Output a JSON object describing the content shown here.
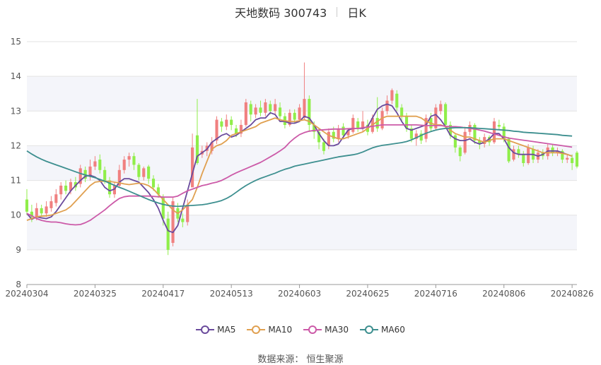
{
  "header": {
    "title": "天地数码 300743",
    "period": "日K"
  },
  "footer": {
    "source": "数据来源： 恒生聚源"
  },
  "chart_data": {
    "type": "candlestick",
    "colors": {
      "up": "#f08080",
      "down": "#90ee4a",
      "MA5": "#6a4a9c",
      "MA10": "#e0a050",
      "MA30": "#cc5aa8",
      "MA60": "#3d8f8f"
    },
    "ylim": [
      8,
      15
    ],
    "yticks": [
      8,
      9,
      10,
      11,
      12,
      13,
      14,
      15
    ],
    "xtick_labels": [
      "20240304",
      "20240325",
      "20240417",
      "20240513",
      "20240603",
      "20240625",
      "20240716",
      "20240806",
      "20240826"
    ],
    "xtick_positions": [
      0,
      14,
      28,
      42,
      56,
      70,
      84,
      98,
      112
    ],
    "legend": [
      "MA5",
      "MA10",
      "MA30",
      "MA60"
    ],
    "candles": [
      {
        "o": 10.45,
        "c": 10.1,
        "h": 10.75,
        "l": 10.0
      },
      {
        "o": 10.1,
        "c": 9.95,
        "h": 10.3,
        "l": 9.8
      },
      {
        "o": 9.95,
        "c": 10.2,
        "h": 10.35,
        "l": 9.85
      },
      {
        "o": 10.2,
        "c": 10.05,
        "h": 10.3,
        "l": 9.95
      },
      {
        "o": 10.05,
        "c": 10.25,
        "h": 10.4,
        "l": 9.95
      },
      {
        "o": 10.2,
        "c": 10.4,
        "h": 10.55,
        "l": 10.1
      },
      {
        "o": 10.35,
        "c": 10.6,
        "h": 10.75,
        "l": 10.25
      },
      {
        "o": 10.6,
        "c": 10.85,
        "h": 10.95,
        "l": 10.45
      },
      {
        "o": 10.85,
        "c": 10.7,
        "h": 11.0,
        "l": 10.6
      },
      {
        "o": 10.7,
        "c": 10.95,
        "h": 11.05,
        "l": 10.6
      },
      {
        "o": 10.95,
        "c": 10.8,
        "h": 11.1,
        "l": 10.7
      },
      {
        "o": 10.9,
        "c": 11.35,
        "h": 11.45,
        "l": 10.8
      },
      {
        "o": 11.3,
        "c": 11.05,
        "h": 11.4,
        "l": 10.95
      },
      {
        "o": 11.1,
        "c": 11.4,
        "h": 11.6,
        "l": 11.0
      },
      {
        "o": 11.4,
        "c": 11.55,
        "h": 11.7,
        "l": 11.3
      },
      {
        "o": 11.6,
        "c": 11.3,
        "h": 11.75,
        "l": 11.2
      },
      {
        "o": 11.3,
        "c": 11.0,
        "h": 11.4,
        "l": 10.9
      },
      {
        "o": 11.0,
        "c": 10.6,
        "h": 11.1,
        "l": 10.5
      },
      {
        "o": 10.6,
        "c": 10.85,
        "h": 10.95,
        "l": 10.5
      },
      {
        "o": 10.85,
        "c": 11.3,
        "h": 11.45,
        "l": 10.8
      },
      {
        "o": 11.3,
        "c": 11.6,
        "h": 11.7,
        "l": 11.2
      },
      {
        "o": 11.6,
        "c": 11.7,
        "h": 11.8,
        "l": 11.4
      },
      {
        "o": 11.7,
        "c": 11.45,
        "h": 11.8,
        "l": 11.3
      },
      {
        "o": 11.45,
        "c": 11.1,
        "h": 11.5,
        "l": 11.0
      },
      {
        "o": 11.1,
        "c": 11.35,
        "h": 11.4,
        "l": 11.0
      },
      {
        "o": 11.4,
        "c": 11.05,
        "h": 11.45,
        "l": 10.9
      },
      {
        "o": 11.05,
        "c": 10.8,
        "h": 11.15,
        "l": 10.7
      },
      {
        "o": 10.8,
        "c": 10.6,
        "h": 10.9,
        "l": 10.5
      },
      {
        "o": 10.5,
        "c": 9.9,
        "h": 10.6,
        "l": 9.7
      },
      {
        "o": 9.9,
        "c": 9.0,
        "h": 10.1,
        "l": 8.85
      },
      {
        "o": 9.2,
        "c": 10.4,
        "h": 10.5,
        "l": 9.1
      },
      {
        "o": 10.2,
        "c": 9.9,
        "h": 10.35,
        "l": 9.8
      },
      {
        "o": 9.9,
        "c": 9.8,
        "h": 10.05,
        "l": 9.65
      },
      {
        "o": 9.8,
        "c": 10.3,
        "h": 10.45,
        "l": 9.7
      },
      {
        "o": 10.8,
        "c": 11.95,
        "h": 12.35,
        "l": 11.2
      },
      {
        "o": 12.3,
        "c": 11.5,
        "h": 13.35,
        "l": 11.45
      },
      {
        "o": 11.75,
        "c": 11.85,
        "h": 12.0,
        "l": 11.65
      },
      {
        "o": 11.85,
        "c": 12.0,
        "h": 12.1,
        "l": 11.7
      },
      {
        "o": 11.85,
        "c": 12.1,
        "h": 12.25,
        "l": 11.75
      },
      {
        "o": 12.15,
        "c": 12.75,
        "h": 12.85,
        "l": 12.05
      },
      {
        "o": 12.7,
        "c": 12.55,
        "h": 12.8,
        "l": 12.4
      },
      {
        "o": 12.55,
        "c": 12.75,
        "h": 12.9,
        "l": 12.45
      },
      {
        "o": 12.75,
        "c": 12.6,
        "h": 12.85,
        "l": 12.45
      },
      {
        "o": 12.5,
        "c": 12.35,
        "h": 12.6,
        "l": 12.25
      },
      {
        "o": 12.35,
        "c": 12.6,
        "h": 12.75,
        "l": 12.25
      },
      {
        "o": 12.6,
        "c": 13.25,
        "h": 13.35,
        "l": 12.55
      },
      {
        "o": 13.2,
        "c": 12.9,
        "h": 13.3,
        "l": 12.7
      },
      {
        "o": 12.9,
        "c": 13.1,
        "h": 13.2,
        "l": 12.8
      },
      {
        "o": 13.1,
        "c": 12.95,
        "h": 13.3,
        "l": 12.85
      },
      {
        "o": 12.95,
        "c": 13.25,
        "h": 13.35,
        "l": 12.85
      },
      {
        "o": 13.2,
        "c": 13.0,
        "h": 13.3,
        "l": 12.9
      },
      {
        "o": 13.0,
        "c": 13.2,
        "h": 13.35,
        "l": 12.9
      },
      {
        "o": 13.1,
        "c": 12.85,
        "h": 13.25,
        "l": 12.75
      },
      {
        "o": 12.85,
        "c": 12.6,
        "h": 12.95,
        "l": 12.5
      },
      {
        "o": 12.6,
        "c": 12.95,
        "h": 13.05,
        "l": 12.55
      },
      {
        "o": 12.95,
        "c": 12.75,
        "h": 13.05,
        "l": 12.65
      },
      {
        "o": 12.75,
        "c": 13.1,
        "h": 13.2,
        "l": 12.7
      },
      {
        "o": 12.8,
        "c": 13.35,
        "h": 14.4,
        "l": 12.75
      },
      {
        "o": 13.35,
        "c": 12.6,
        "h": 13.45,
        "l": 12.4
      },
      {
        "o": 12.6,
        "c": 12.4,
        "h": 12.7,
        "l": 12.2
      },
      {
        "o": 12.4,
        "c": 12.1,
        "h": 12.5,
        "l": 11.9
      },
      {
        "o": 12.1,
        "c": 11.85,
        "h": 12.2,
        "l": 11.75
      },
      {
        "o": 12.0,
        "c": 12.4,
        "h": 12.5,
        "l": 11.9
      },
      {
        "o": 12.4,
        "c": 12.2,
        "h": 12.55,
        "l": 12.1
      },
      {
        "o": 12.2,
        "c": 12.5,
        "h": 12.6,
        "l": 12.1
      },
      {
        "o": 12.55,
        "c": 12.3,
        "h": 12.65,
        "l": 12.2
      },
      {
        "o": 12.3,
        "c": 12.45,
        "h": 12.5,
        "l": 12.2
      },
      {
        "o": 12.4,
        "c": 12.8,
        "h": 12.9,
        "l": 12.35
      },
      {
        "o": 12.7,
        "c": 12.5,
        "h": 12.8,
        "l": 12.4
      },
      {
        "o": 12.5,
        "c": 12.7,
        "h": 13.0,
        "l": 12.4
      },
      {
        "o": 12.6,
        "c": 12.4,
        "h": 12.75,
        "l": 12.3
      },
      {
        "o": 12.4,
        "c": 12.8,
        "h": 12.9,
        "l": 12.35
      },
      {
        "o": 12.8,
        "c": 12.5,
        "h": 13.4,
        "l": 12.4
      },
      {
        "o": 12.5,
        "c": 13.0,
        "h": 13.1,
        "l": 12.45
      },
      {
        "o": 13.0,
        "c": 13.3,
        "h": 13.45,
        "l": 12.9
      },
      {
        "o": 13.3,
        "c": 13.6,
        "h": 13.65,
        "l": 13.2
      },
      {
        "o": 13.5,
        "c": 13.1,
        "h": 13.6,
        "l": 13.0
      },
      {
        "o": 13.1,
        "c": 12.85,
        "h": 13.2,
        "l": 12.7
      },
      {
        "o": 12.85,
        "c": 12.5,
        "h": 12.95,
        "l": 12.4
      },
      {
        "o": 12.5,
        "c": 12.2,
        "h": 12.6,
        "l": 12.1
      },
      {
        "o": 12.2,
        "c": 12.35,
        "h": 12.45,
        "l": 12.0
      },
      {
        "o": 12.35,
        "c": 12.15,
        "h": 12.45,
        "l": 12.05
      },
      {
        "o": 12.2,
        "c": 12.8,
        "h": 12.9,
        "l": 12.1
      },
      {
        "o": 12.8,
        "c": 12.5,
        "h": 12.95,
        "l": 12.4
      },
      {
        "o": 12.5,
        "c": 13.1,
        "h": 13.2,
        "l": 12.45
      },
      {
        "o": 13.0,
        "c": 13.2,
        "h": 13.3,
        "l": 12.9
      },
      {
        "o": 13.2,
        "c": 12.6,
        "h": 13.25,
        "l": 12.5
      },
      {
        "o": 12.6,
        "c": 12.3,
        "h": 12.7,
        "l": 12.2
      },
      {
        "o": 12.3,
        "c": 11.95,
        "h": 12.35,
        "l": 11.8
      },
      {
        "o": 11.95,
        "c": 11.7,
        "h": 12.0,
        "l": 11.55
      },
      {
        "o": 11.8,
        "c": 12.4,
        "h": 12.55,
        "l": 11.75
      },
      {
        "o": 12.4,
        "c": 12.6,
        "h": 12.7,
        "l": 12.3
      },
      {
        "o": 12.6,
        "c": 12.15,
        "h": 12.65,
        "l": 12.05
      },
      {
        "o": 12.15,
        "c": 12.05,
        "h": 12.25,
        "l": 11.9
      },
      {
        "o": 12.05,
        "c": 12.25,
        "h": 12.35,
        "l": 11.95
      },
      {
        "o": 12.25,
        "c": 12.1,
        "h": 12.3,
        "l": 12.0
      },
      {
        "o": 12.1,
        "c": 12.7,
        "h": 12.8,
        "l": 12.05
      },
      {
        "o": 12.6,
        "c": 12.55,
        "h": 12.75,
        "l": 12.45
      },
      {
        "o": 12.55,
        "c": 12.2,
        "h": 12.65,
        "l": 12.1
      },
      {
        "o": 12.2,
        "c": 11.55,
        "h": 12.25,
        "l": 11.5
      },
      {
        "o": 11.6,
        "c": 11.9,
        "h": 12.0,
        "l": 11.55
      },
      {
        "o": 11.9,
        "c": 11.75,
        "h": 12.0,
        "l": 11.65
      },
      {
        "o": 11.75,
        "c": 11.5,
        "h": 11.85,
        "l": 11.4
      },
      {
        "o": 11.5,
        "c": 11.95,
        "h": 12.05,
        "l": 11.45
      },
      {
        "o": 11.9,
        "c": 11.6,
        "h": 12.0,
        "l": 11.5
      },
      {
        "o": 11.6,
        "c": 11.8,
        "h": 11.9,
        "l": 11.5
      },
      {
        "o": 11.8,
        "c": 11.7,
        "h": 11.9,
        "l": 11.6
      },
      {
        "o": 11.7,
        "c": 11.95,
        "h": 12.05,
        "l": 11.6
      },
      {
        "o": 11.95,
        "c": 11.8,
        "h": 12.05,
        "l": 11.7
      },
      {
        "o": 11.8,
        "c": 11.85,
        "h": 11.95,
        "l": 11.7
      },
      {
        "o": 11.85,
        "c": 11.6,
        "h": 11.9,
        "l": 11.5
      },
      {
        "o": 11.6,
        "c": 11.65,
        "h": 11.75,
        "l": 11.5
      },
      {
        "o": 11.65,
        "c": 11.5,
        "h": 11.75,
        "l": 11.3
      },
      {
        "o": 11.8,
        "c": 11.4,
        "h": 11.85,
        "l": 11.35
      }
    ],
    "series": [
      {
        "name": "MA5",
        "values": [
          10.05,
          9.88,
          9.95,
          9.92,
          9.9,
          9.95,
          10.1,
          10.3,
          10.5,
          10.7,
          10.85,
          11.0,
          11.12,
          11.15,
          11.1,
          11.0,
          10.8,
          10.7,
          10.75,
          10.95,
          11.05,
          11.05,
          11.0,
          10.95,
          10.8,
          10.65,
          10.45,
          10.2,
          9.85,
          9.55,
          9.5,
          9.7,
          10.2,
          10.7,
          11.2,
          11.7,
          11.8,
          11.9,
          12.1,
          12.2,
          12.3,
          12.35,
          12.25,
          12.3,
          12.4,
          12.5,
          12.6,
          12.75,
          12.8,
          12.8,
          12.95,
          12.9,
          12.7,
          12.7,
          12.65,
          12.65,
          12.7,
          12.85,
          12.8,
          12.6,
          12.35,
          12.15,
          12.0,
          12.0,
          12.05,
          12.25,
          12.45,
          12.5,
          12.5,
          12.5,
          12.55,
          12.8,
          13.05,
          13.15,
          13.2,
          13.15,
          12.95,
          12.7,
          12.5,
          12.45,
          12.5,
          12.55,
          12.6,
          12.85,
          12.9,
          12.75,
          12.55,
          12.3,
          12.2,
          12.15,
          12.15,
          12.2,
          12.1,
          12.05,
          12.1,
          12.2,
          12.35,
          12.35,
          12.2,
          11.95,
          11.8,
          11.75,
          11.75,
          11.75,
          11.75,
          11.7,
          11.75,
          11.85,
          11.85,
          11.85,
          11.8,
          11.75,
          11.7
        ]
      },
      {
        "name": "MA10",
        "values": [
          9.85,
          9.9,
          9.95,
          9.97,
          9.98,
          10.0,
          10.05,
          10.1,
          10.15,
          10.25,
          10.4,
          10.55,
          10.7,
          10.85,
          10.95,
          10.97,
          10.98,
          10.97,
          10.95,
          10.93,
          10.9,
          10.88,
          10.9,
          10.92,
          10.9,
          10.85,
          10.75,
          10.6,
          10.45,
          10.3,
          10.15,
          10.05,
          10.15,
          10.3,
          10.45,
          10.8,
          11.2,
          11.55,
          11.9,
          12.0,
          12.05,
          12.15,
          12.3,
          12.35,
          12.4,
          12.45,
          12.5,
          12.55,
          12.65,
          12.7,
          12.75,
          12.8,
          12.75,
          12.72,
          12.7,
          12.7,
          12.72,
          12.75,
          12.7,
          12.6,
          12.5,
          12.4,
          12.3,
          12.25,
          12.2,
          12.2,
          12.25,
          12.3,
          12.35,
          12.4,
          12.5,
          12.6,
          12.7,
          12.8,
          12.85,
          12.85,
          12.85,
          12.85,
          12.85,
          12.85,
          12.85,
          12.8,
          12.7,
          12.65,
          12.6,
          12.6,
          12.55,
          12.45,
          12.35,
          12.3,
          12.25,
          12.25,
          12.2,
          12.15,
          12.1,
          12.15,
          12.2,
          12.2,
          12.2,
          12.15,
          12.1,
          12.05,
          12.0,
          11.95,
          11.9,
          11.85,
          11.8,
          11.8,
          11.8,
          11.8,
          11.78,
          11.75,
          11.7
        ]
      },
      {
        "name": "MA30",
        "values": [
          10.05,
          9.98,
          9.9,
          9.85,
          9.82,
          9.8,
          9.8,
          9.78,
          9.75,
          9.73,
          9.72,
          9.73,
          9.78,
          9.85,
          9.95,
          10.05,
          10.15,
          10.27,
          10.38,
          10.48,
          10.53,
          10.55,
          10.55,
          10.55,
          10.55,
          10.55,
          10.54,
          10.53,
          10.52,
          10.52,
          10.52,
          10.55,
          10.63,
          10.7,
          10.75,
          10.8,
          10.85,
          10.88,
          10.92,
          10.95,
          11.0,
          11.07,
          11.15,
          11.22,
          11.28,
          11.34,
          11.4,
          11.46,
          11.52,
          11.6,
          11.68,
          11.76,
          11.85,
          11.95,
          12.1,
          12.22,
          12.32,
          12.38,
          12.42,
          12.44,
          12.45,
          12.46,
          12.47,
          12.48,
          12.48,
          12.48,
          12.49,
          12.5,
          12.5,
          12.52,
          12.54,
          12.56,
          12.58,
          12.6,
          12.6,
          12.6,
          12.6,
          12.6,
          12.6,
          12.6,
          12.6,
          12.59,
          12.58,
          12.58,
          12.58,
          12.58,
          12.56,
          12.55,
          12.55,
          12.54,
          12.52,
          12.5,
          12.48,
          12.45,
          12.42,
          12.38,
          12.34,
          12.3,
          12.26,
          12.22,
          12.2,
          12.18,
          12.16,
          12.14,
          12.12,
          12.1,
          12.08,
          12.06,
          12.04,
          12.02,
          12.0,
          11.98,
          11.96
        ]
      },
      {
        "name": "MA60",
        "values": [
          11.85,
          11.76,
          11.68,
          11.61,
          11.55,
          11.5,
          11.45,
          11.4,
          11.35,
          11.3,
          11.25,
          11.2,
          11.16,
          11.12,
          11.08,
          11.03,
          10.98,
          10.92,
          10.86,
          10.8,
          10.75,
          10.69,
          10.63,
          10.57,
          10.51,
          10.45,
          10.4,
          10.35,
          10.31,
          10.28,
          10.26,
          10.25,
          10.26,
          10.27,
          10.28,
          10.29,
          10.3,
          10.32,
          10.35,
          10.38,
          10.42,
          10.48,
          10.56,
          10.66,
          10.76,
          10.85,
          10.93,
          11.0,
          11.06,
          11.11,
          11.16,
          11.21,
          11.27,
          11.32,
          11.36,
          11.41,
          11.44,
          11.47,
          11.5,
          11.53,
          11.56,
          11.59,
          11.62,
          11.65,
          11.68,
          11.7,
          11.72,
          11.74,
          11.77,
          11.82,
          11.88,
          11.94,
          11.98,
          12.01,
          12.03,
          12.05,
          12.07,
          12.09,
          12.12,
          12.17,
          12.23,
          12.3,
          12.36,
          12.41,
          12.45,
          12.48,
          12.5,
          12.51,
          12.52,
          12.52,
          12.52,
          12.52,
          12.51,
          12.5,
          12.49,
          12.48,
          12.47,
          12.46,
          12.45,
          12.44,
          12.42,
          12.41,
          12.39,
          12.38,
          12.37,
          12.36,
          12.35,
          12.34,
          12.33,
          12.32,
          12.3,
          12.29,
          12.28
        ]
      }
    ]
  }
}
